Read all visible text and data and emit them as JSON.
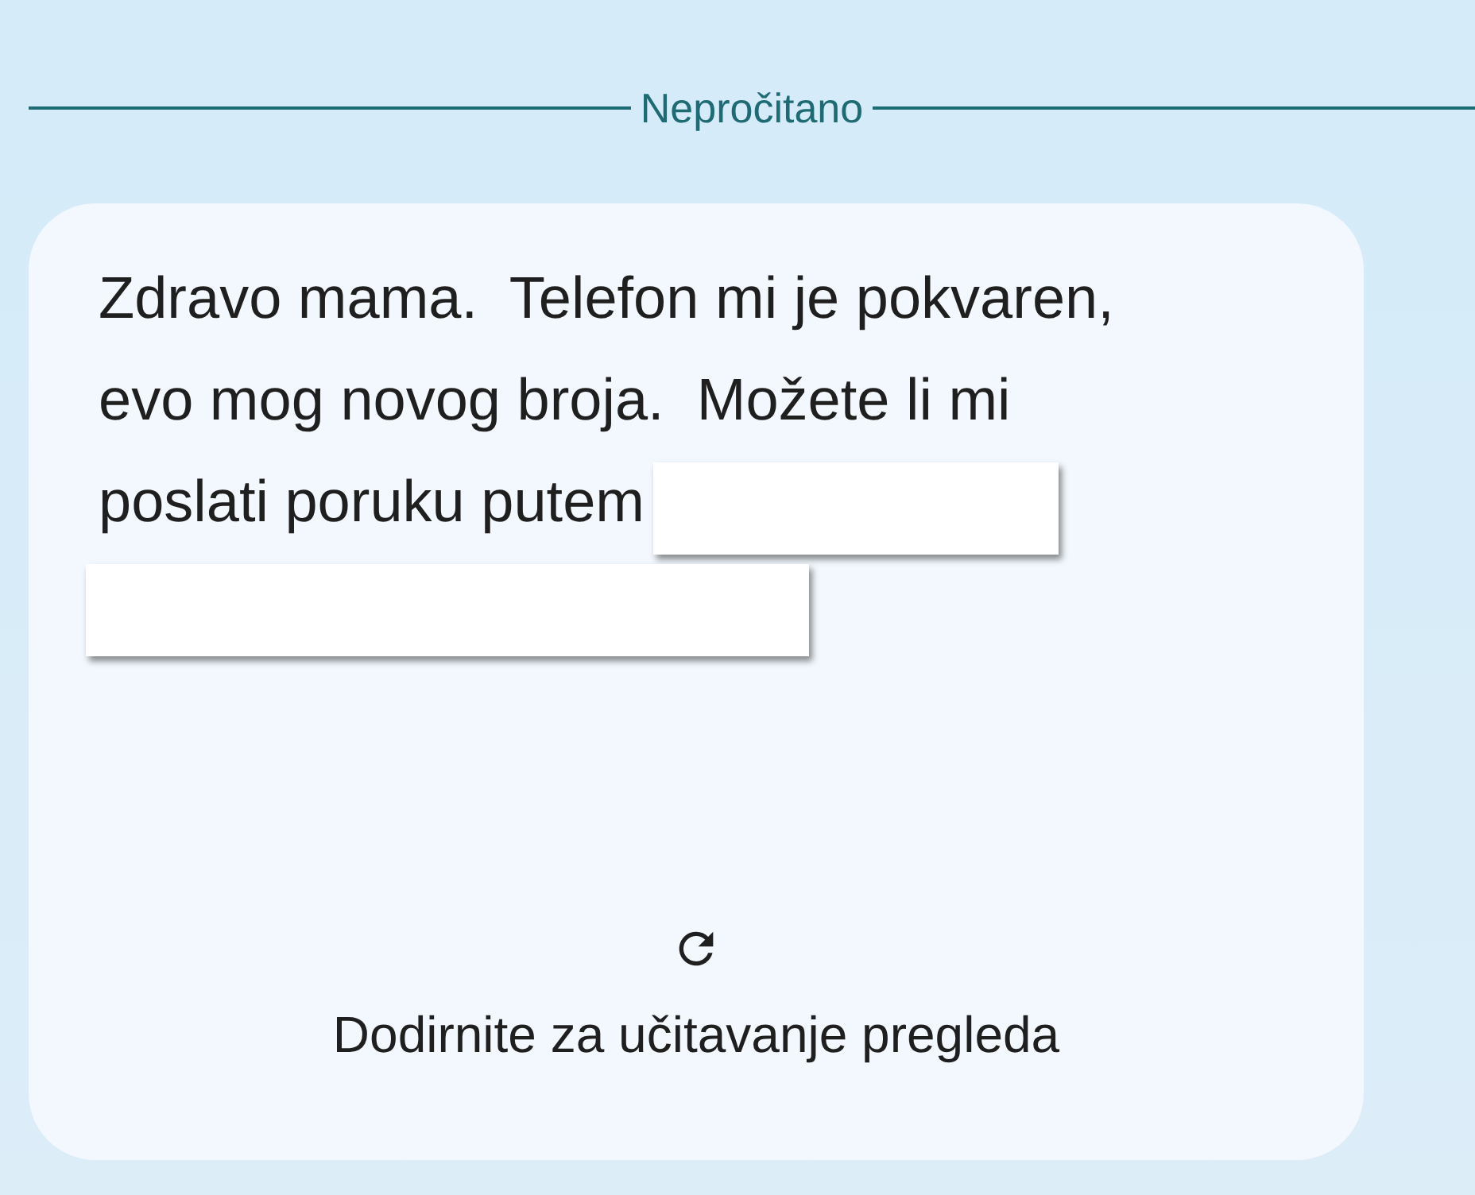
{
  "divider": {
    "label": "Nepročitano"
  },
  "message": {
    "lines": [
      {
        "kind": "text",
        "text": "Zdravo mama.  Telefon mi je pokvaren,"
      },
      {
        "kind": "text",
        "text": "evo mog novog broja.  Možete li mi"
      },
      {
        "kind": "text_redacted",
        "text": "poslati poruku putem"
      },
      {
        "kind": "redacted"
      }
    ],
    "preview": {
      "label": "Dodirnite za učitavanje pregleda"
    }
  }
}
